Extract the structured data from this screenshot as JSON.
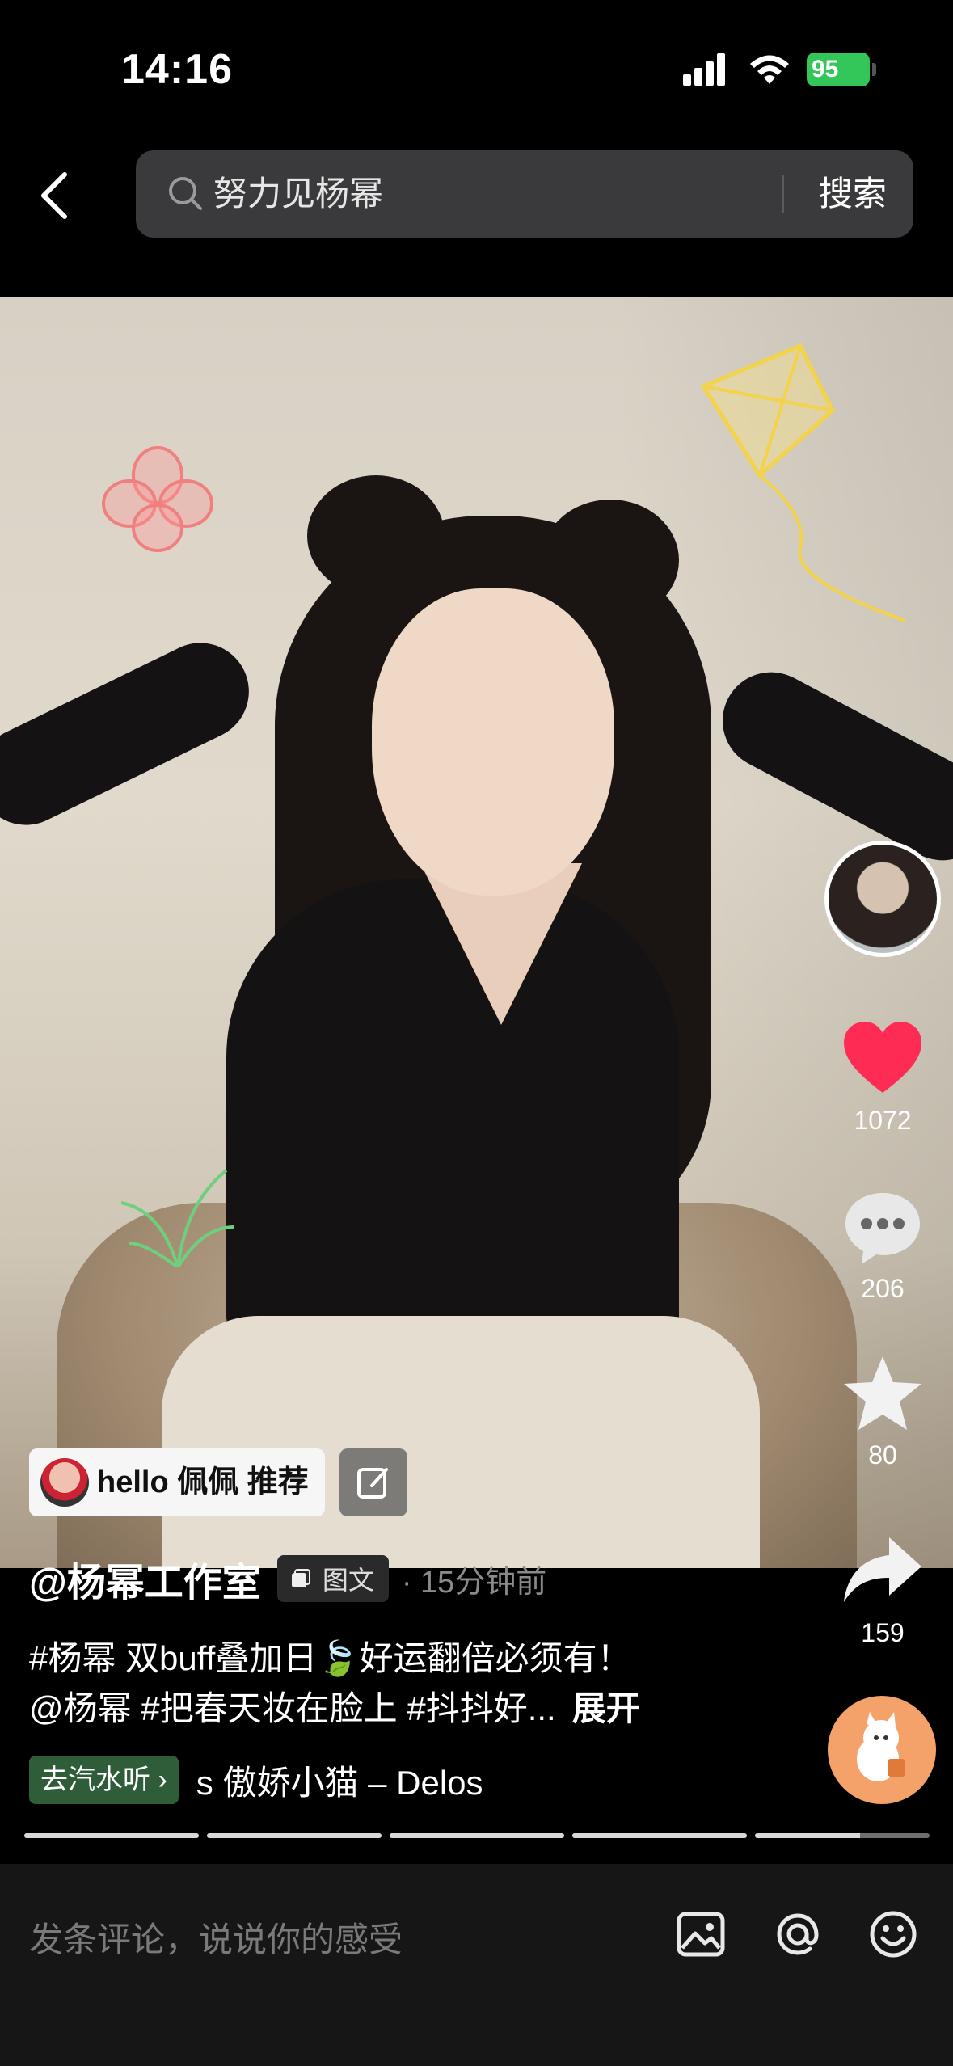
{
  "status_bar": {
    "time": "14:16",
    "battery": "95"
  },
  "header": {
    "search_query": "努力见杨幂",
    "search_button": "搜索"
  },
  "actions": {
    "likes": "1072",
    "comments": "206",
    "favorites": "80",
    "shares": "159"
  },
  "recommend": {
    "text": "hello 佩佩 推荐"
  },
  "post": {
    "author": "@杨幂工作室",
    "type_tag": "图文",
    "time_ago": "· 15分钟前",
    "caption_line1": "#杨幂  双buff叠加日🍃好运翻倍必须有！",
    "caption_line2": "@杨幂   #把春天妆在脸上 #抖抖好...",
    "expand": "展开"
  },
  "music": {
    "cta": "去汽水听 ›",
    "title": "s    傲娇小猫 – Delos"
  },
  "progress": [
    1,
    1,
    1,
    1,
    0.6
  ],
  "comment_bar": {
    "placeholder": "发条评论，说说你的感受"
  },
  "colors": {
    "like": "#fe2c55",
    "battery": "#33c759",
    "music_cta": "#2f5d3a"
  }
}
